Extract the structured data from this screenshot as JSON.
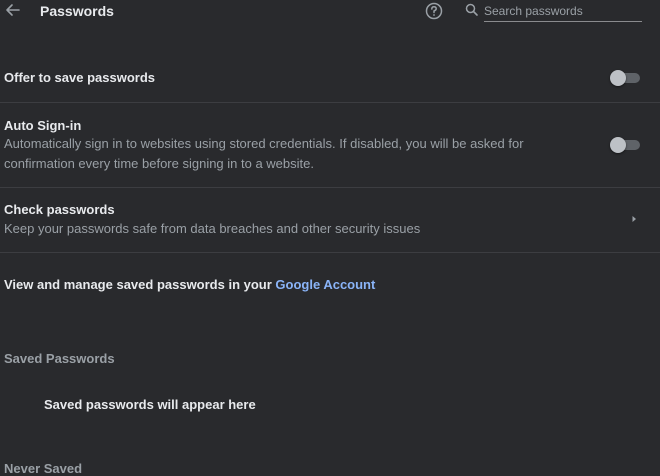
{
  "header": {
    "title": "Passwords",
    "search_placeholder": "Search passwords"
  },
  "settings": {
    "offer_to_save": {
      "label": "Offer to save passwords",
      "enabled": false
    },
    "auto_signin": {
      "label": "Auto Sign-in",
      "description": "Automatically sign in to websites using stored credentials. If disabled, you will be asked for confirmation every time before signing in to a website.",
      "enabled": false
    },
    "check_passwords": {
      "label": "Check passwords",
      "description": "Keep your passwords safe from data breaches and other security issues"
    }
  },
  "manage": {
    "text": "View and manage saved passwords in your ",
    "link": "Google Account"
  },
  "saved_passwords": {
    "header": "Saved Passwords",
    "empty_message": "Saved passwords will appear here"
  },
  "never_saved": {
    "header": "Never Saved"
  },
  "colors": {
    "background": "#292a2d",
    "text": "#e8eaed",
    "secondary_text": "#9aa0a6",
    "link": "#8ab4f8"
  }
}
